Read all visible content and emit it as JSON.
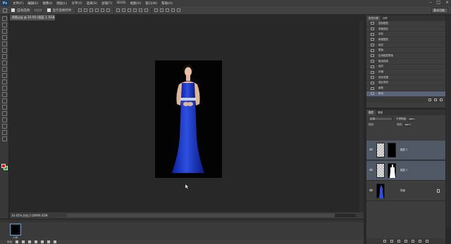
{
  "app": {
    "logo": "Ps",
    "menus": [
      "文件(F)",
      "编辑(E)",
      "图像(I)",
      "图层(L)",
      "文字(Y)",
      "选择(S)",
      "滤镜(T)",
      "3D(D)",
      "视图(V)",
      "窗口(W)",
      "帮助(H)"
    ],
    "window_buttons": [
      "–",
      "□",
      "×"
    ]
  },
  "options_bar": {
    "auto_select_label": "自动选择:",
    "show_transform_label": "显示变换控件",
    "workspace": "基本功能"
  },
  "document": {
    "tab_title": "原图.jpg @ 34.4% (图层 1, RGB/8)",
    "zoom": "34.45%",
    "info": "文档:2.60M/9.05M"
  },
  "colors": {
    "foreground": "#e0141b",
    "background": "#1ea41e",
    "selection": "#5a6478"
  },
  "history_panel": {
    "tabs": [
      "历史记录",
      "动作"
    ],
    "items": [
      "复制图层",
      "收缩选区",
      "羽化",
      "新建图层",
      "填充",
      "蒙版",
      "应用图层蒙版",
      "取消选择",
      "色阶",
      "存储",
      "色彩范围",
      "选区修改",
      "画笔",
      "移动"
    ]
  },
  "layers_panel": {
    "tabs": [
      "图层",
      "通道"
    ],
    "blend_mode": "正常",
    "opacity_label": "不透明度:",
    "opacity": "100%",
    "lock_label": "锁定:",
    "fill_label": "填充:",
    "fill": "100%",
    "layers": [
      {
        "name": "图层 2",
        "selected": true
      },
      {
        "name": "图层 1",
        "selected": true
      },
      {
        "name": "背景",
        "selected": false
      }
    ]
  },
  "timeline": {
    "frame_time": "0 秒",
    "loop": "永远"
  }
}
